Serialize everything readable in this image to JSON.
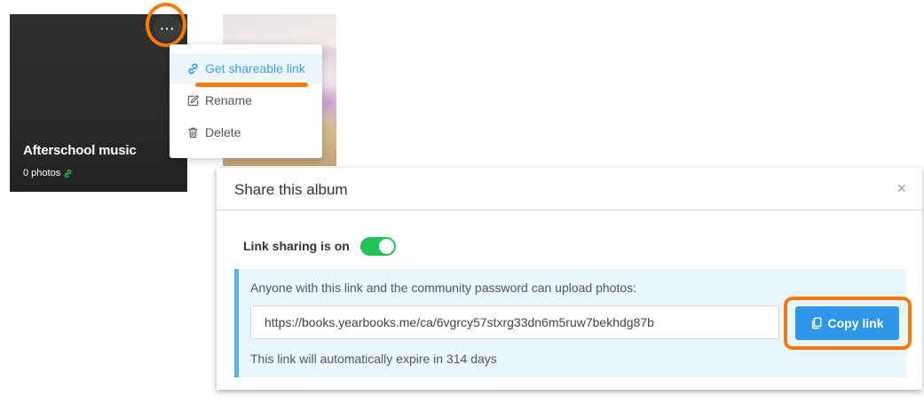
{
  "album": {
    "title": "Afterschool music",
    "count": "0 photos",
    "more_label": "···"
  },
  "menu": {
    "items": [
      {
        "label": "Get shareable link",
        "icon": "link-icon"
      },
      {
        "label": "Rename",
        "icon": "edit-icon"
      },
      {
        "label": "Delete",
        "icon": "trash-icon"
      }
    ]
  },
  "modal": {
    "title": "Share this album",
    "close": "×",
    "toggle_label": "Link sharing is on",
    "toggle_on": true,
    "info": "Anyone with this link and the community password can upload photos:",
    "link": "https://books.yearbooks.me/ca/6vgrcy57stxrg33dn6m5ruw7bekhdg87b",
    "copy_label": "Copy link",
    "expire": "This link will automatically expire in 314 days"
  },
  "colors": {
    "accent_blue": "#2f96e8",
    "toggle_green": "#22c25a",
    "highlight_orange": "#f47b0b",
    "link_green": "#22c25a"
  }
}
